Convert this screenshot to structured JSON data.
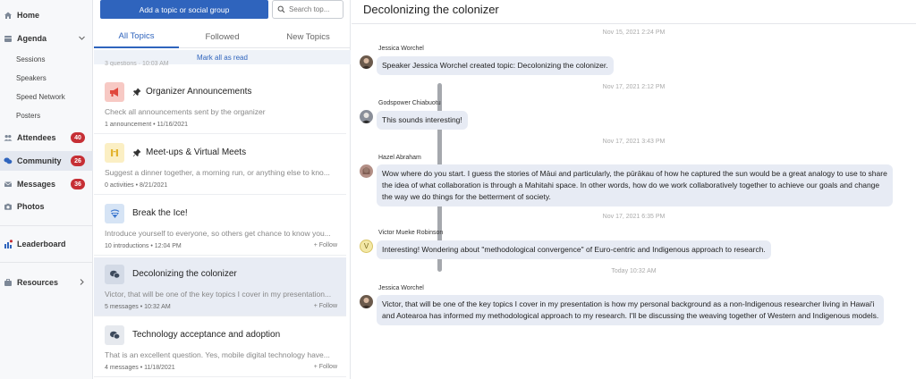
{
  "nav": {
    "home": "Home",
    "agenda": "Agenda",
    "sessions": "Sessions",
    "speakers": "Speakers",
    "speed_network": "Speed Network",
    "posters": "Posters",
    "attendees": "Attendees",
    "attendees_count": "40",
    "community": "Community",
    "community_count": "26",
    "messages": "Messages",
    "messages_count": "36",
    "photos": "Photos",
    "leaderboard": "Leaderboard",
    "resources": "Resources"
  },
  "topics": {
    "add_button": "Add a topic or social group",
    "search_placeholder": "Search top...",
    "tabs": [
      "All Topics",
      "Followed",
      "New Topics"
    ],
    "mark_all": "Mark all as read",
    "stub_text": "3 questions  ·  10:03 AM",
    "follow_label": "Follow",
    "items": [
      {
        "title": "Organizer Announcements",
        "desc": "Check all announcements sent by the organizer",
        "count": "1 announcement",
        "date": "11/16/2021",
        "icon": "megaphone-icon",
        "pinned": true
      },
      {
        "title": "Meet-ups & Virtual Meets",
        "desc": "Suggest a dinner together, a morning run, or anything else to kno...",
        "count": "0 activities",
        "date": "8/21/2021",
        "icon": "meetup-icon",
        "pinned": true
      },
      {
        "title": "Break the Ice!",
        "desc": "Introduce yourself to everyone, so others get chance to know you...",
        "count": "10 introductions",
        "date": "12:04 PM",
        "icon": "icebreaker-icon",
        "pinned": false
      },
      {
        "title": "Decolonizing the colonizer",
        "desc": "Victor, that will be one of the key topics I cover in my presentation...",
        "count": "5 messages",
        "date": "10:32 AM",
        "icon": "chat-bubbles-icon",
        "pinned": false
      },
      {
        "title": "Technology acceptance and adoption",
        "desc": "That is an excellent question. Yes, mobile digital technology have...",
        "count": "4 messages",
        "date": "11/18/2021",
        "icon": "chat-bubbles-icon",
        "pinned": false
      }
    ]
  },
  "chat": {
    "title": "Decolonizing the colonizer",
    "messages": [
      {
        "time": "Nov 15, 2021 2:24 PM",
        "author": "Jessica Worchel",
        "lines": [
          "Speaker Jessica Worchel created topic: Decolonizing the colonizer."
        ]
      },
      {
        "time": "Nov 17, 2021 2:12 PM",
        "author": "Godspower Chiabuotu",
        "lines": [
          "This sounds interesting!"
        ]
      },
      {
        "time": "Nov 17, 2021 3:43 PM",
        "author": "Hazel Abraham",
        "lines": [
          "Wow where do you start. I guess the stories of Māui and particularly, the pūrākau of how he captured the sun would be a great analogy to use to share",
          "the idea of what collaboration is through a Mahitahi space. In other words, how do we work collaboratively together to achieve our goals and change",
          "the way we do things for the betterment of society."
        ]
      },
      {
        "time": "Nov 17, 2021 6:35 PM",
        "author": "Victor Mueke Robinson",
        "avatar_letter": "V",
        "lines": [
          "Interesting! Wondering about \"methodological convergence\" of Euro-centric and Indigenous approach to research."
        ]
      },
      {
        "time": "Today 10:32 AM",
        "author": "Jessica Worchel",
        "lines": [
          "Victor, that will be one of the key topics I cover in my presentation is how my personal background as a non-Indigenous researcher living in Hawai'i",
          "and Aotearoa has informed my methodological approach to my research. I'll be discussing the weaving together of Western and Indigenous models."
        ]
      }
    ]
  },
  "colors": {
    "accent": "#2f64bd",
    "badge": "#c62f35",
    "bubble": "#e7ebf4"
  }
}
